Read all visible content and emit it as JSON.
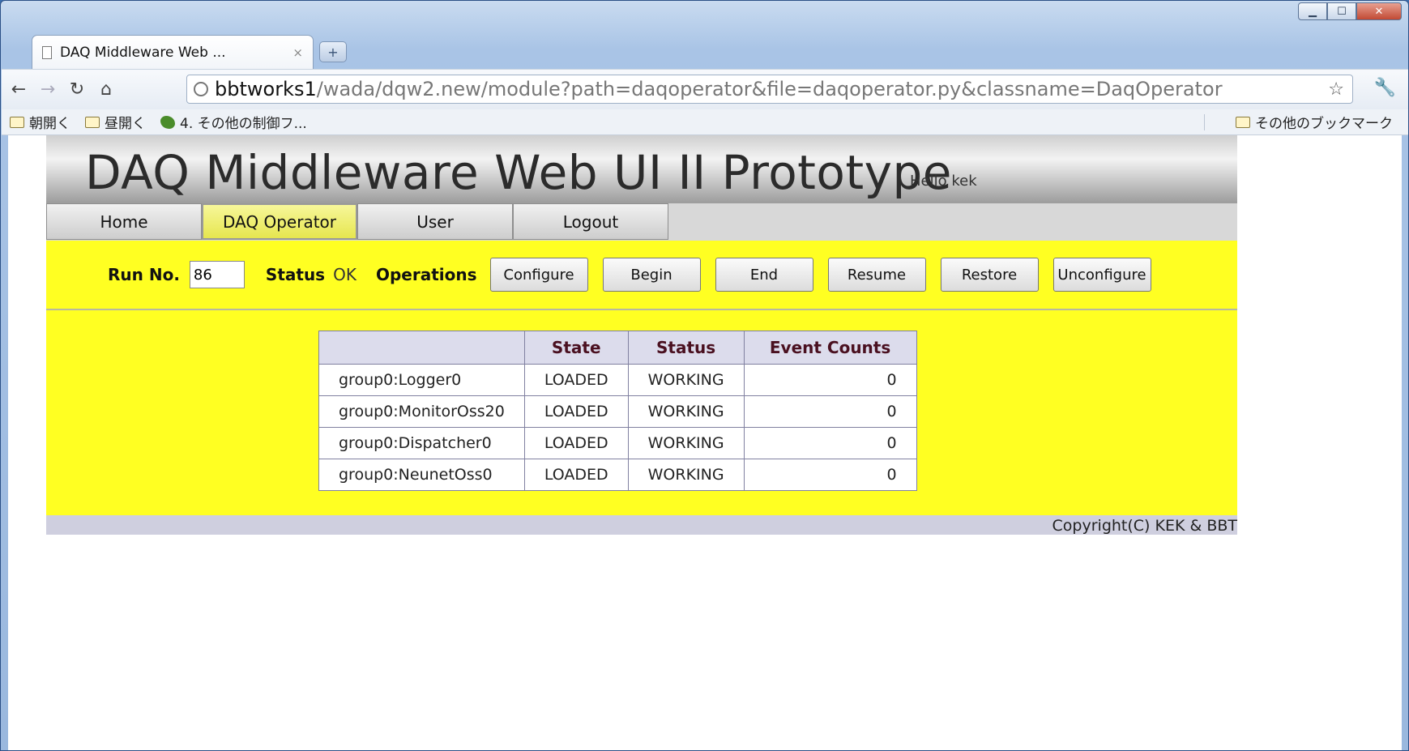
{
  "browser": {
    "tab_title": "DAQ Middleware Web ...",
    "tab_close": "×",
    "new_tab": "+",
    "url_host": "bbtworks1",
    "url_rest": "/wada/dqw2.new/module?path=daqoperator&file=daqoperator.py&classname=DaqOperator",
    "bookmarks": [
      {
        "label": "朝開く",
        "icon": "folder-icon"
      },
      {
        "label": "昼開く",
        "icon": "folder-icon"
      },
      {
        "label": "4. その他の制御フ...",
        "icon": "bookmark-favicon"
      }
    ],
    "other_bookmarks": "その他のブックマーク"
  },
  "page": {
    "title": "DAQ Middleware Web UI II Prototype",
    "greeting": "Hello kek",
    "menu": [
      {
        "label": "Home"
      },
      {
        "label": "DAQ Operator"
      },
      {
        "label": "User"
      },
      {
        "label": "Logout"
      }
    ],
    "controls": {
      "run_label": "Run No.",
      "run_value": "86",
      "status_label": "Status",
      "status_value": "OK",
      "operations_label": "Operations",
      "buttons": [
        "Configure",
        "Begin",
        "End",
        "Resume",
        "Restore",
        "Unconfigure"
      ]
    },
    "table": {
      "headers": [
        "",
        "State",
        "Status",
        "Event Counts"
      ],
      "rows": [
        {
          "name": "group0:Logger0",
          "state": "LOADED",
          "status": "WORKING",
          "count": "0"
        },
        {
          "name": "group0:MonitorOss20",
          "state": "LOADED",
          "status": "WORKING",
          "count": "0"
        },
        {
          "name": "group0:Dispatcher0",
          "state": "LOADED",
          "status": "WORKING",
          "count": "0"
        },
        {
          "name": "group0:NeunetOss0",
          "state": "LOADED",
          "status": "WORKING",
          "count": "0"
        }
      ]
    },
    "footer": "Copyright(C) KEK & BBT"
  },
  "colors": {
    "panel_yellow": "#ffff22",
    "active_tab": "#f0f06a",
    "header_cell": "#dcdcec"
  }
}
